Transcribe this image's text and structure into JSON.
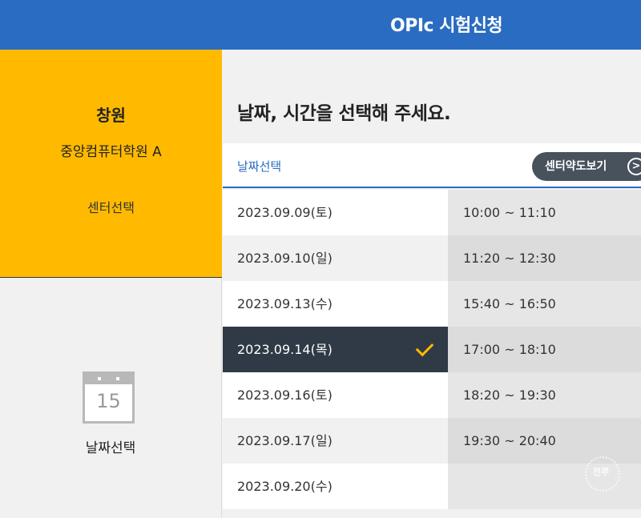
{
  "header": {
    "title": "OPIc 시험신청"
  },
  "center_panel": {
    "city": "창원",
    "academy": "중앙컴퓨터학원 A",
    "select_label": "센터선택"
  },
  "date_panel": {
    "calendar_icon_number": "15",
    "select_label": "날짜선택"
  },
  "main": {
    "heading": "날짜, 시간을 선택해 주세요.",
    "tab_label": "날짜선택",
    "map_button": "센터약도보기",
    "map_button_icon": "arrow-right-circle-icon"
  },
  "dates": [
    {
      "date": "2023.09.09(토)",
      "selected": false
    },
    {
      "date": "2023.09.10(일)",
      "selected": false
    },
    {
      "date": "2023.09.13(수)",
      "selected": false
    },
    {
      "date": "2023.09.14(목)",
      "selected": true
    },
    {
      "date": "2023.09.16(토)",
      "selected": false
    },
    {
      "date": "2023.09.17(일)",
      "selected": false
    },
    {
      "date": "2023.09.20(수)",
      "selected": false
    }
  ],
  "times": [
    "10:00 ~ 11:10",
    "11:20 ~ 12:30",
    "15:40 ~ 16:50",
    "17:00 ~ 18:10",
    "18:20 ~ 19:30",
    "19:30 ~ 20:40"
  ],
  "badge": {
    "label": "전쭈"
  },
  "colors": {
    "header": "#2a6cc2",
    "accent": "#ffba00",
    "selected_row": "#2f3a46"
  }
}
